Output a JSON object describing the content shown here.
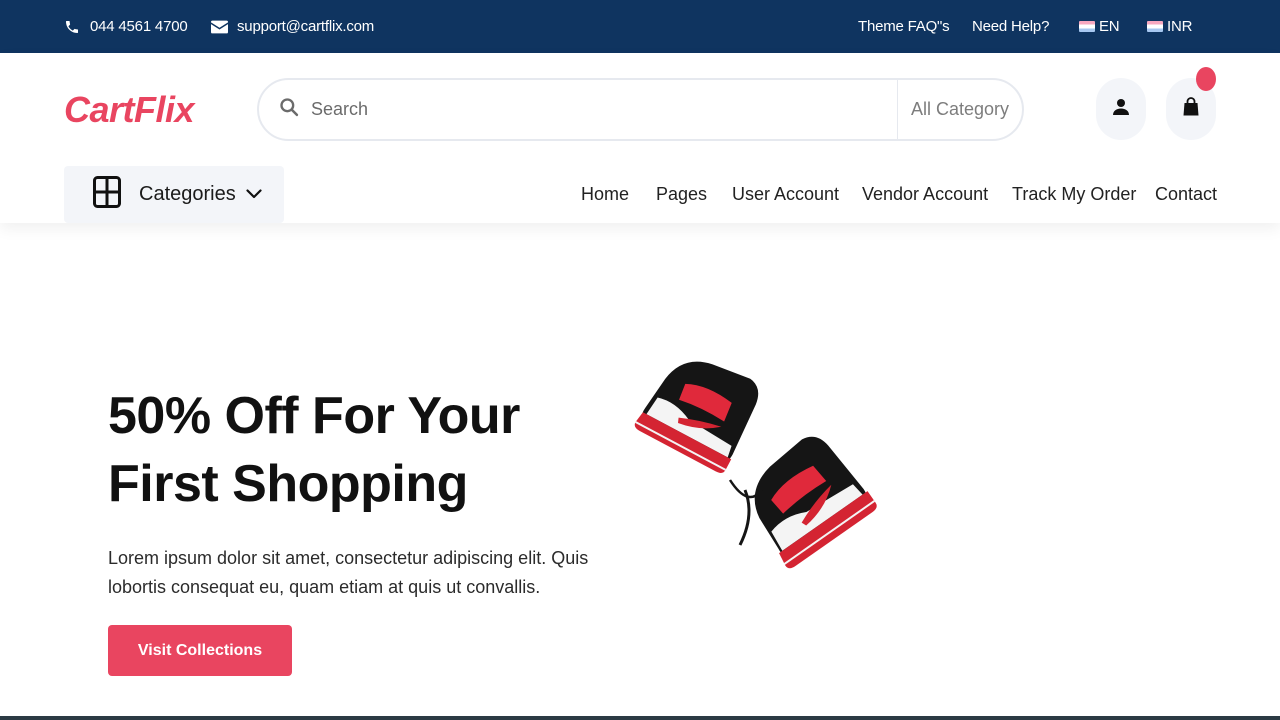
{
  "topbar": {
    "phone": "044 4561 4700",
    "email": "support@cartflix.com",
    "faq": "Theme FAQ\"s",
    "help": "Need Help?",
    "language": "EN",
    "currency": "INR",
    "icons": {
      "phone": "phone-icon",
      "email": "mail-icon",
      "language_flag": "flag-icon",
      "currency_flag": "flag-icon"
    }
  },
  "header": {
    "logo": "CartFlix",
    "search": {
      "placeholder": "Search",
      "category": "All Category",
      "icon": "search-icon"
    },
    "user_icon": "user-icon",
    "cart_icon": "shopping-bag-icon",
    "categories_label": "Categories",
    "nav": [
      "Home",
      "Pages",
      "User Account",
      "Vendor Account",
      "Track My Order",
      "Contact"
    ]
  },
  "hero": {
    "title": "50% Off For Your First Shopping",
    "description": "Lorem ipsum dolor sit amet, consectetur adipiscing elit. Quis lobortis consequat eu, quam etiam at quis ut convallis.",
    "button": "Visit Collections",
    "image": "sneakers-image"
  },
  "colors": {
    "topbar": "#0f3460",
    "accent": "#e94560",
    "light_bg": "#f3f5f9"
  }
}
